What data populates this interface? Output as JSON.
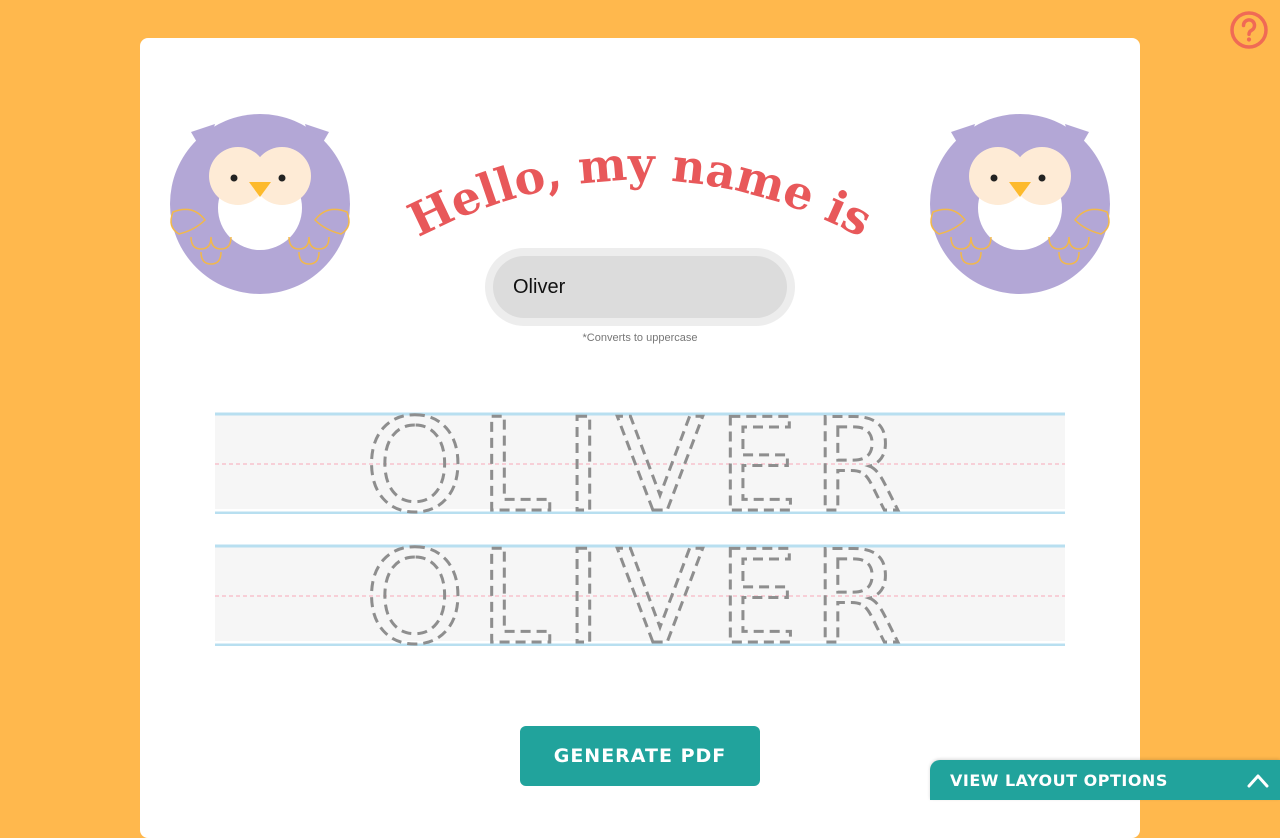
{
  "heading": {
    "text": "Hello, my name is"
  },
  "name_field": {
    "value": "Oliver",
    "hint": "*Converts to uppercase"
  },
  "practice": {
    "rows": [
      {
        "text": "OLIVER"
      },
      {
        "text": "OLIVER"
      }
    ]
  },
  "buttons": {
    "generate_pdf": "GENERATE PDF",
    "layout_options": "VIEW LAYOUT OPTIONS"
  },
  "icons": {
    "help": "help-icon",
    "owl": "owl-icon",
    "layout_toggle": "chevron-up-icon"
  },
  "colors": {
    "background": "#FFB84D",
    "heading": "#E8585A",
    "accent": "#21A39C",
    "owl_body": "#B3A7D6",
    "help": "#F06A55"
  }
}
